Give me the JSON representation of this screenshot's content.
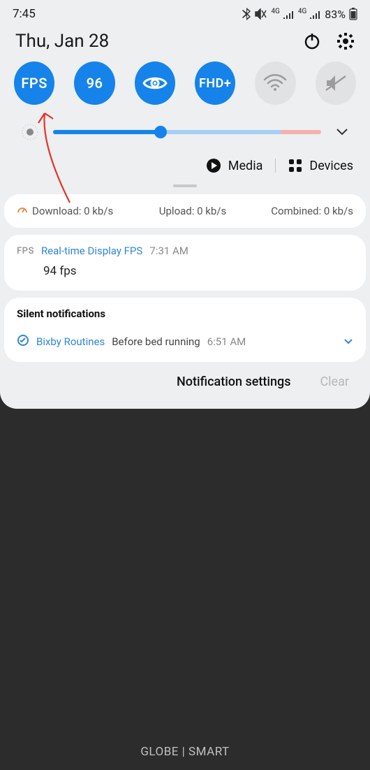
{
  "status": {
    "time": "7:45",
    "net_label": "4G",
    "battery_pct": "83%"
  },
  "header": {
    "date": "Thu, Jan 28"
  },
  "toggles": [
    {
      "label": "FPS",
      "active": true
    },
    {
      "label": "96",
      "active": true
    },
    {
      "label": "eye",
      "active": true
    },
    {
      "label": "FHD+",
      "active": true
    },
    {
      "label": "wifi",
      "active": false
    },
    {
      "label": "mute",
      "active": false
    }
  ],
  "media_row": {
    "media": "Media",
    "devices": "Devices"
  },
  "speed": {
    "download": "Download: 0 kb/s",
    "upload": "Upload: 0 kb/s",
    "combined": "Combined: 0 kb/s"
  },
  "fps_notif": {
    "tag": "FPS",
    "title": "Real-time Display FPS",
    "time": "7:31 AM",
    "body": "94 fps"
  },
  "silent_header": "Silent notifications",
  "bixby": {
    "title": "Bixby Routines",
    "body": "Before bed running",
    "time": "6:51 AM"
  },
  "footer": {
    "settings": "Notification settings",
    "clear": "Clear"
  },
  "carrier": "GLOBE | SMART"
}
